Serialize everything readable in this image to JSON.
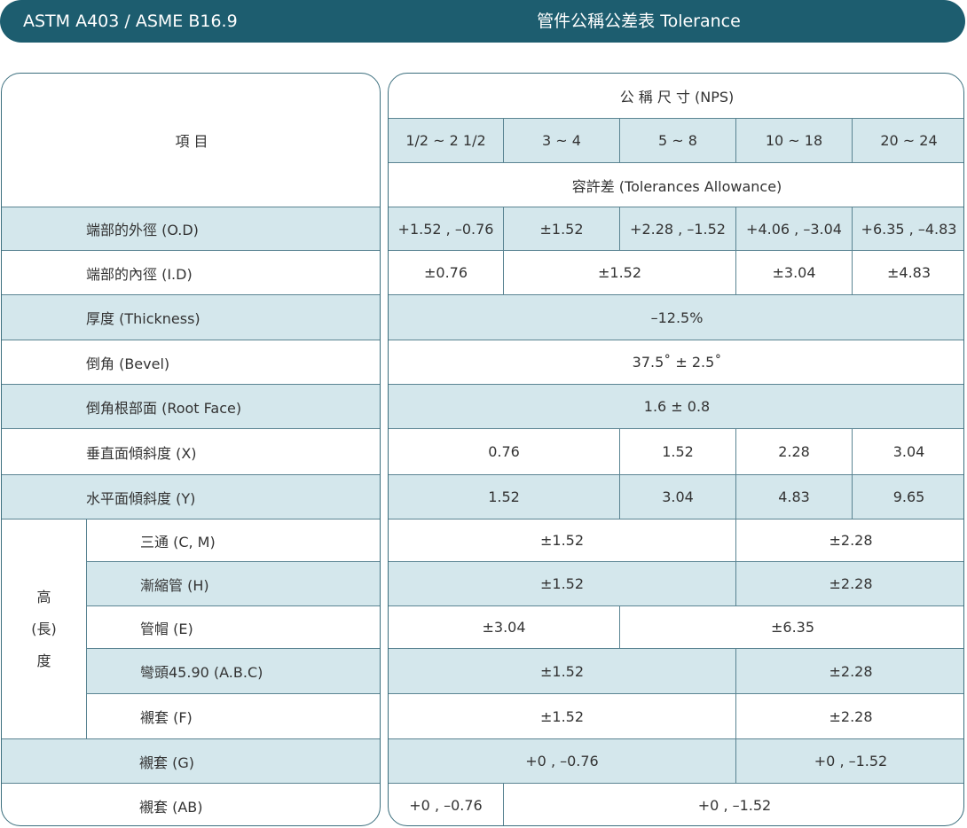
{
  "header": {
    "standard": "ASTM A403 / ASME B16.9",
    "title": "管件公稱公差表 Tolerance"
  },
  "table": {
    "item_header": "項 目",
    "nps_header": "公 稱 尺 寸 (NPS)",
    "nps_ranges": [
      "1/2 ~ 2 1/2",
      "3 ~ 4",
      "5 ~ 8",
      "10 ~ 18",
      "20 ~ 24"
    ],
    "tolerance_header": "容許差 (Tolerances Allowance)",
    "rows": {
      "od": {
        "label": "端部的外徑 (O.D)",
        "values": [
          "+1.52 , –0.76",
          "±1.52",
          "+2.28 , –1.52",
          "+4.06 , –3.04",
          "+6.35 , –4.83"
        ]
      },
      "id": {
        "label": "端部的內徑 (I.D)",
        "values": [
          "±0.76",
          "±1.52",
          "±3.04",
          "±4.83"
        ]
      },
      "thickness": {
        "label": "厚度 (Thickness)",
        "value": "–12.5%"
      },
      "bevel": {
        "label": "倒角 (Bevel)",
        "value": "37.5˚ ± 2.5˚"
      },
      "root_face": {
        "label": "倒角根部面 (Root Face)",
        "value": "1.6 ± 0.8"
      },
      "x": {
        "label": "垂直面傾斜度 (X)",
        "values": [
          "0.76",
          "1.52",
          "2.28",
          "3.04"
        ]
      },
      "y": {
        "label": "水平面傾斜度 (Y)",
        "values": [
          "1.52",
          "3.04",
          "4.83",
          "9.65"
        ]
      },
      "height_group": [
        "高",
        "(長)",
        "度"
      ],
      "cm": {
        "label": "三通 (C, M)",
        "values": [
          "±1.52",
          "±2.28"
        ]
      },
      "h": {
        "label": "漸縮管 (H)",
        "values": [
          "±1.52",
          "±2.28"
        ]
      },
      "e": {
        "label": "管帽 (E)",
        "values": [
          "±3.04",
          "±6.35"
        ]
      },
      "abc": {
        "label": "彎頭45.90 (A.B.C)",
        "values": [
          "±1.52",
          "±2.28"
        ]
      },
      "f": {
        "label": "襯套 (F)",
        "values": [
          "±1.52",
          "±2.28"
        ]
      },
      "g": {
        "label": "襯套 (G)",
        "values": [
          "+0 , –0.76",
          "+0 , –1.52"
        ]
      },
      "ab": {
        "label": "襯套 (AB)",
        "values": [
          "+0 , –0.76",
          "+0 , –1.52"
        ]
      }
    }
  }
}
